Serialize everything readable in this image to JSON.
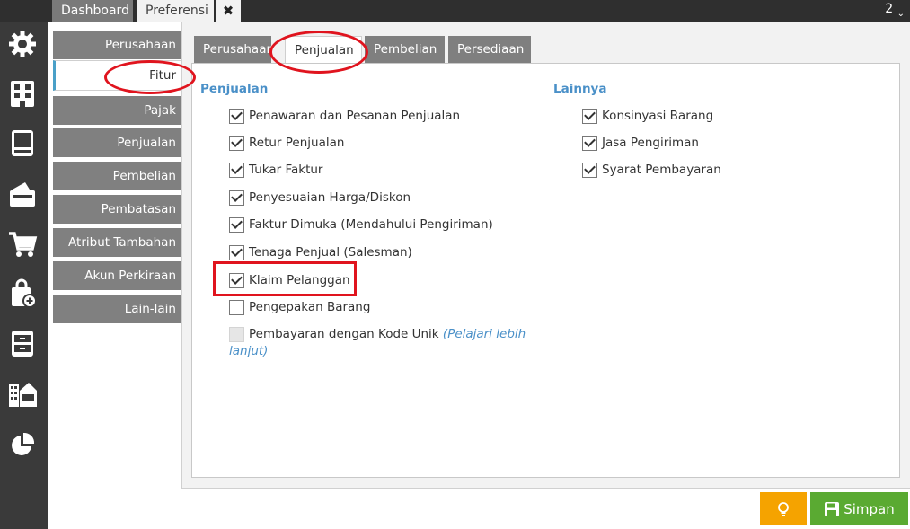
{
  "topbar": {
    "tabs": [
      {
        "label": "Dashboard"
      },
      {
        "label": "Preferensi"
      }
    ],
    "close_glyph": "✖",
    "count": "2",
    "count_chevron": "⌄"
  },
  "iconbar": {
    "icons": [
      "gear-icon",
      "building-icon",
      "book-icon",
      "wallet-icon",
      "cart-icon",
      "bag-add-icon",
      "cabinet-icon",
      "warehouse-icon",
      "pie-chart-icon"
    ]
  },
  "menu": {
    "items": [
      {
        "label": "Perusahaan"
      },
      {
        "label": "Fitur"
      },
      {
        "label": "Pajak"
      },
      {
        "label": "Penjualan"
      },
      {
        "label": "Pembelian"
      },
      {
        "label": "Pembatasan"
      },
      {
        "label": "Atribut Tambahan"
      },
      {
        "label": "Akun Perkiraan"
      },
      {
        "label": "Lain-lain"
      }
    ],
    "active": "Fitur"
  },
  "inner_tabs": [
    {
      "label": "Perusahaan"
    },
    {
      "label": "Penjualan"
    },
    {
      "label": "Pembelian"
    },
    {
      "label": "Persediaan"
    }
  ],
  "sections": {
    "penjualan": {
      "title": "Penjualan",
      "items": [
        {
          "label": "Penawaran dan Pesanan Penjualan",
          "checked": true
        },
        {
          "label": "Retur Penjualan",
          "checked": true
        },
        {
          "label": "Tukar Faktur",
          "checked": true
        },
        {
          "label": "Penyesuaian Harga/Diskon",
          "checked": true
        },
        {
          "label": "Faktur Dimuka (Mendahului Pengiriman)",
          "checked": true
        },
        {
          "label": "Tenaga Penjual (Salesman)",
          "checked": true
        },
        {
          "label": "Klaim Pelanggan",
          "checked": true
        },
        {
          "label": "Pengepakan Barang",
          "checked": false
        },
        {
          "label": "Pembayaran dengan Kode Unik",
          "checked": false,
          "disabled": true,
          "link_part1": "(Pelajari lebih",
          "link_part2": "lanjut)"
        }
      ]
    },
    "lainnya": {
      "title": "Lainnya",
      "items": [
        {
          "label": "Konsinyasi Barang",
          "checked": true
        },
        {
          "label": "Jasa Pengiriman",
          "checked": true
        },
        {
          "label": "Syarat Pembayaran",
          "checked": true
        }
      ]
    }
  },
  "buttons": {
    "save_label": "Simpan"
  },
  "colors": {
    "accent_blue": "#4a90c8",
    "menu_gray": "#808080",
    "annotation_red": "#e0141e",
    "tip_orange": "#f5a300",
    "save_green": "#5aaa32"
  }
}
